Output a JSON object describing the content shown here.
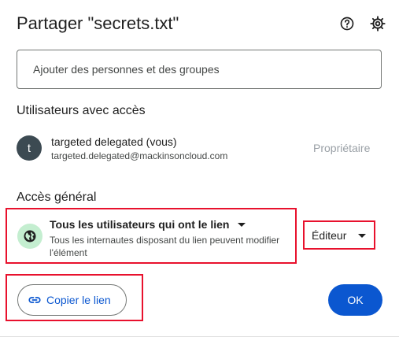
{
  "dialog": {
    "title": "Partager \"secrets.txt\"",
    "help_icon": "help-circle-icon",
    "settings_icon": "gear-icon"
  },
  "search": {
    "placeholder": "Ajouter des personnes et des groupes",
    "value": ""
  },
  "users_section": {
    "title": "Utilisateurs avec accès",
    "users": [
      {
        "avatar_letter": "t",
        "name": "targeted delegated (vous)",
        "email": "targeted.delegated@mackinsoncloud.com",
        "role": "Propriétaire"
      }
    ]
  },
  "general_access": {
    "title": "Accès général",
    "icon": "globe-icon",
    "selected": "Tous les utilisateurs qui ont le lien",
    "description": "Tous les internautes disposant du lien peuvent modifier l'élément",
    "role": "Éditeur"
  },
  "footer": {
    "copy_link_label": "Copier le lien",
    "copy_link_icon": "link-icon",
    "ok_label": "OK"
  },
  "colors": {
    "accent": "#0b57d0",
    "highlight": "#e8112d",
    "avatar": "#3c4a52",
    "globe_background": "#c4eed0"
  }
}
